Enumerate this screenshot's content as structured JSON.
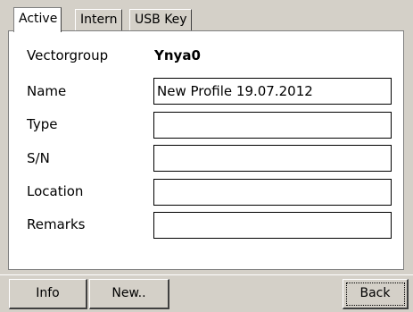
{
  "tabs": [
    {
      "label": "Active",
      "selected": true
    },
    {
      "label": "Intern",
      "selected": false
    },
    {
      "label": "USB Key",
      "selected": false
    }
  ],
  "form": {
    "vectorgroup_label": "Vectorgroup",
    "vectorgroup_value": "Ynya0",
    "name_label": "Name",
    "name_value": "New Profile 19.07.2012",
    "type_label": "Type",
    "type_value": "",
    "sn_label": "S/N",
    "sn_value": "",
    "location_label": "Location",
    "location_value": "",
    "remarks_label": "Remarks",
    "remarks_value": ""
  },
  "buttons": {
    "info_label": "Info",
    "new_label": "New..",
    "back_label": "Back"
  }
}
